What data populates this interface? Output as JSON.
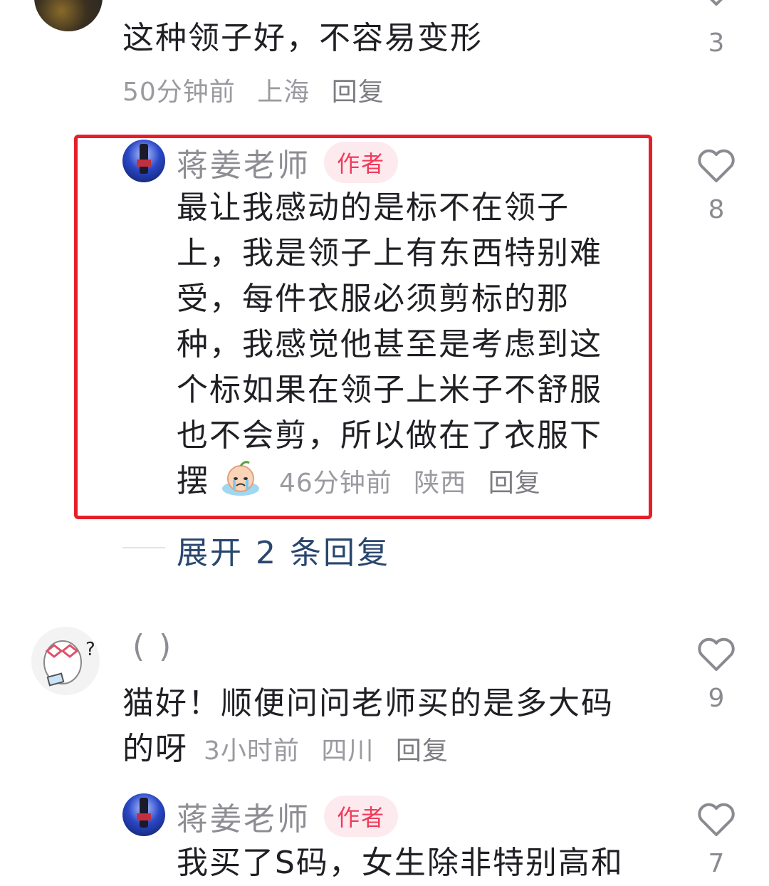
{
  "comment1": {
    "text": "这种领子好，不容易变形",
    "time": "50分钟前",
    "location": "上海",
    "reply": "回复",
    "likes": "3"
  },
  "comment2": {
    "author": "蒋姜老师",
    "badge": "作者",
    "lines": [
      "最让我感动的是标不在领子",
      "上，我是领子上有东西特别难",
      "受，每件衣服必须剪标的那",
      "种，我感觉他甚至是考虑到这",
      "个标如果在领子上米子不舒服",
      "也不会剪，所以做在了衣服下",
      "摆"
    ],
    "emoji": "crying-face-emoji",
    "time": "46分钟前",
    "location": "陕西",
    "reply": "回复",
    "likes": "8",
    "highlight_color": "#e51f2a"
  },
  "expand": {
    "label": "展开 2 条回复"
  },
  "comment3": {
    "author": "( )",
    "lines": [
      "猫好！顺便问问老师买的是多大码",
      "的呀"
    ],
    "time": "3小时前",
    "location": "四川",
    "reply": "回复",
    "likes": "9"
  },
  "comment4": {
    "author": "蒋姜老师",
    "badge": "作者",
    "text": "我买了S码，女生除非特别高和",
    "likes": "7"
  }
}
